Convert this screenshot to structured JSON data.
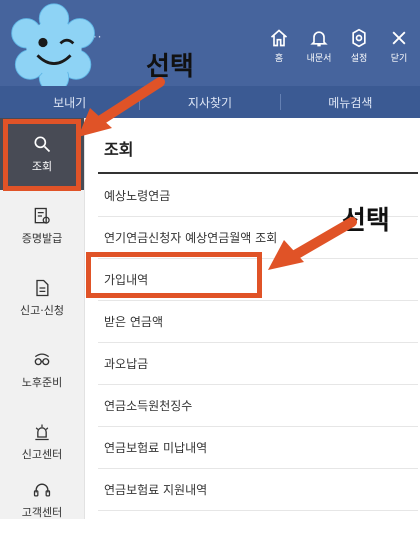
{
  "header": {
    "dots": "···",
    "icons": [
      {
        "name": "home-icon",
        "label": "홈"
      },
      {
        "name": "bell-icon",
        "label": "내문서"
      },
      {
        "name": "gear-icon",
        "label": "설정"
      },
      {
        "name": "close-icon",
        "label": "닫기"
      }
    ]
  },
  "subnav": [
    {
      "label": "보내기"
    },
    {
      "label": "지사찾기"
    },
    {
      "label": "메뉴검색"
    }
  ],
  "sidebar": {
    "items": [
      {
        "icon": "search-icon",
        "label": "조회",
        "active": true
      },
      {
        "icon": "certificate-icon",
        "label": "증명발급"
      },
      {
        "icon": "document-icon",
        "label": "신고·신청"
      },
      {
        "icon": "glasses-icon",
        "label": "노후준비"
      },
      {
        "icon": "alarm-icon",
        "label": "신고센터"
      },
      {
        "icon": "headset-icon",
        "label": "고객센터"
      }
    ]
  },
  "content": {
    "title": "조회",
    "items": [
      {
        "label": "예상노령연금"
      },
      {
        "label": "연기연금신청자 예상연금월액 조회"
      },
      {
        "label": "가입내역"
      },
      {
        "label": "받은 연금액"
      },
      {
        "label": "과오납금"
      },
      {
        "label": "연금소득원천징수"
      },
      {
        "label": "연금보험료 미납내역"
      },
      {
        "label": "연금보험료 지원내역"
      }
    ]
  },
  "annotations": {
    "callout1": "선택",
    "callout2": "선택",
    "color": "#e05327"
  }
}
